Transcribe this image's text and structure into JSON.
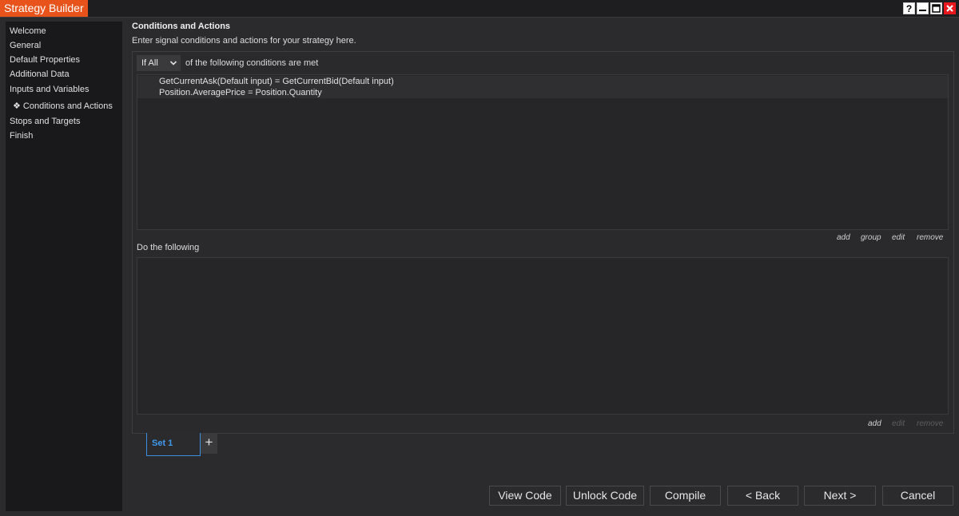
{
  "window": {
    "title": "Strategy Builder"
  },
  "sidebar": {
    "items": [
      {
        "label": "Welcome"
      },
      {
        "label": "General"
      },
      {
        "label": "Default Properties"
      },
      {
        "label": "Additional Data"
      },
      {
        "label": "Inputs and Variables"
      },
      {
        "label": "❖ Conditions and Actions",
        "active": true
      },
      {
        "label": "Stops and Targets"
      },
      {
        "label": "Finish"
      }
    ]
  },
  "main": {
    "title": "Conditions and Actions",
    "description": "Enter signal conditions and actions for your strategy here.",
    "condition_mode": {
      "value": "If All",
      "suffix": "of the following conditions are met"
    },
    "conditions": [
      "GetCurrentAsk(Default input) = GetCurrentBid(Default input)",
      "Position.AveragePrice = Position.Quantity"
    ],
    "condition_links": {
      "add": "add",
      "group": "group",
      "edit": "edit",
      "remove": "remove"
    },
    "actions_label": "Do the following",
    "action_links": {
      "add": "add",
      "edit": "edit",
      "remove": "remove"
    },
    "sets": {
      "active_tab": "Set 1",
      "add_symbol": "+"
    }
  },
  "footer": {
    "view_code": "View Code",
    "unlock_code": "Unlock Code",
    "compile": "Compile",
    "back": "< Back",
    "next": "Next >",
    "cancel": "Cancel"
  },
  "colors": {
    "accent": "#e8531c",
    "tab_active": "#3f9af0",
    "close": "#e8161d"
  }
}
